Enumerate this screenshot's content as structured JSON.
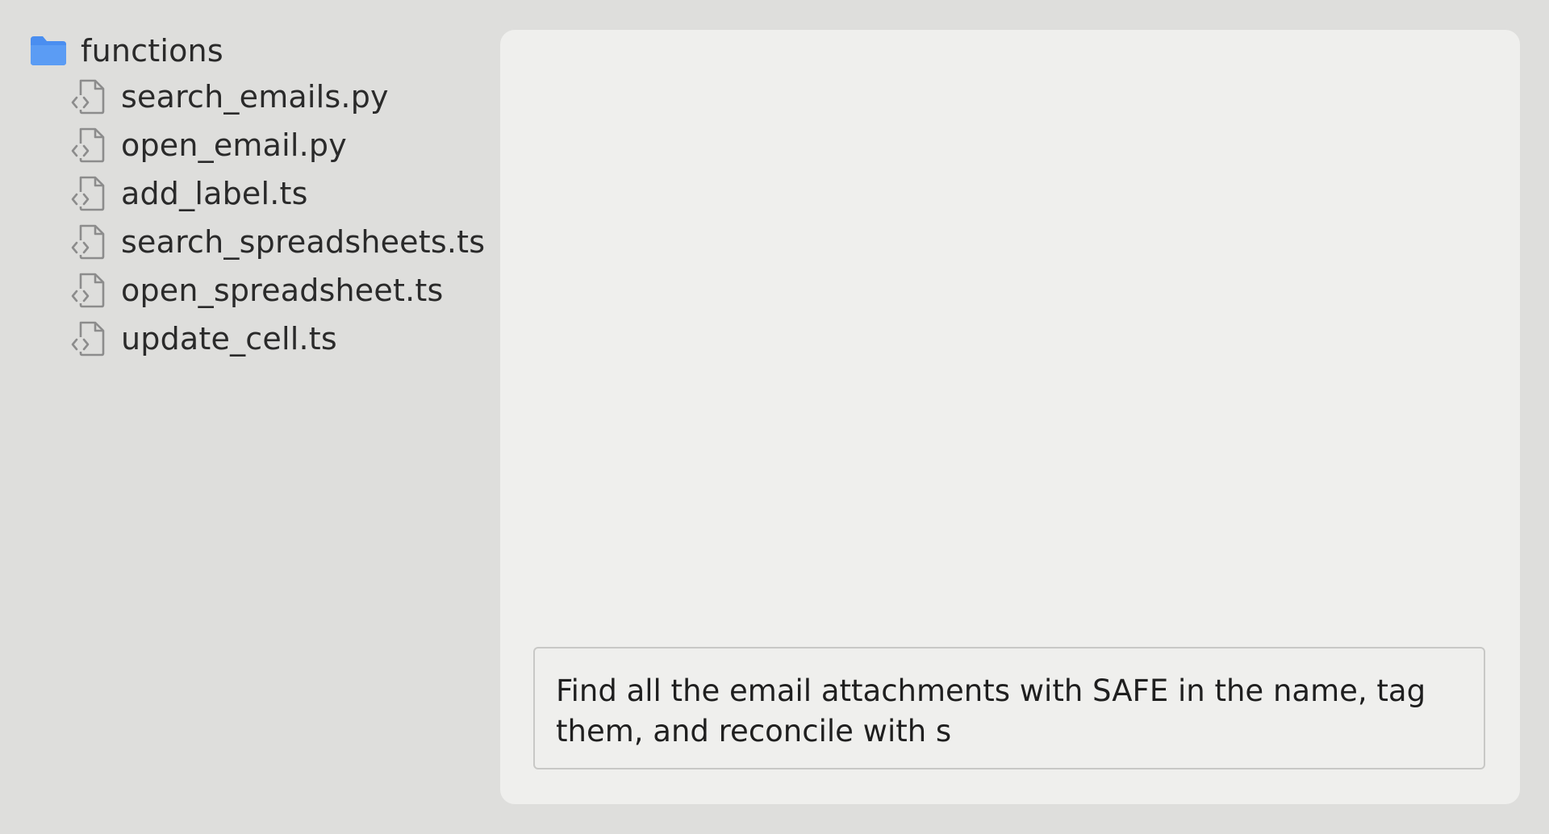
{
  "file_tree": {
    "folder": {
      "name": "functions",
      "icon": "folder-icon",
      "color": "#4a8ef0"
    },
    "files": [
      {
        "name": "search_emails.py",
        "icon": "code-file-icon"
      },
      {
        "name": "open_email.py",
        "icon": "code-file-icon"
      },
      {
        "name": "add_label.ts",
        "icon": "code-file-icon"
      },
      {
        "name": "search_spreadsheets.ts",
        "icon": "code-file-icon"
      },
      {
        "name": "open_spreadsheet.ts",
        "icon": "code-file-icon"
      },
      {
        "name": "update_cell.ts",
        "icon": "code-file-icon"
      }
    ]
  },
  "prompt": {
    "value": "Find all the email attachments with SAFE in the name, tag them, and reconcile with s"
  },
  "colors": {
    "background": "#dededc",
    "panel": "#efefed",
    "folder_accent": "#4a8ef0",
    "file_icon": "#8c8c8c"
  }
}
